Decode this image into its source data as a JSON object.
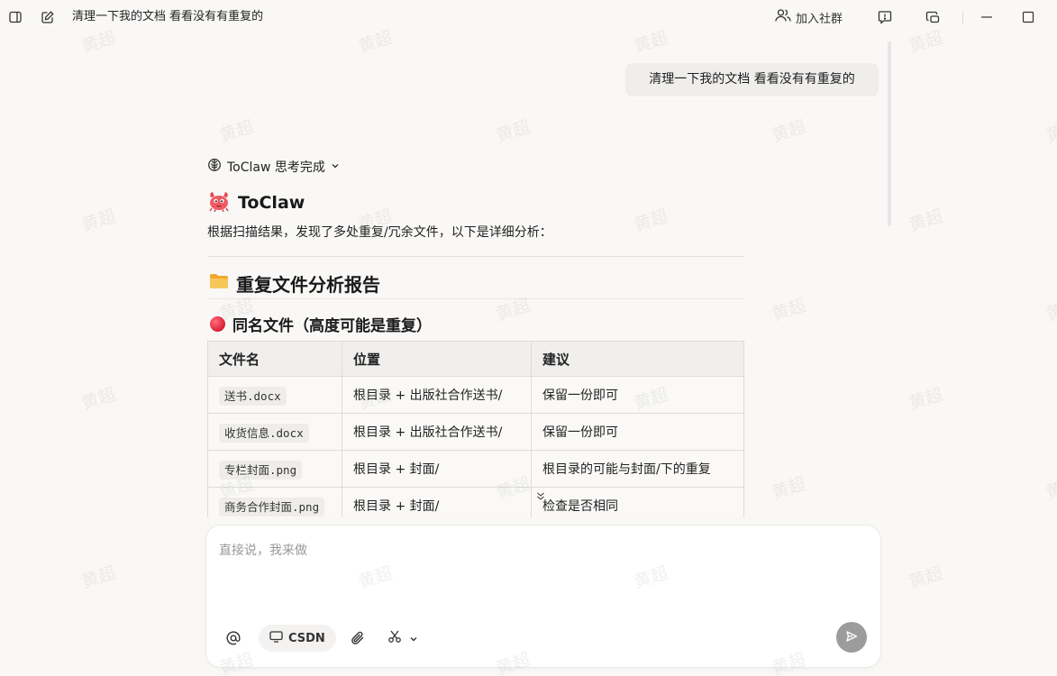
{
  "titlebar": {
    "title": "清理一下我的文档 看看没有有重复的",
    "join_label": "加入社群"
  },
  "watermark": {
    "text": "黄超"
  },
  "conversation": {
    "user_message": "清理一下我的文档 看看没有有重复的",
    "assistant": {
      "think_label": "ToClaw 思考完成",
      "bot_name": "ToClaw",
      "intro": "根据扫描结果，发现了多处重复/冗余文件，以下是详细分析：",
      "report_title": "重复文件分析报告",
      "section_title": "同名文件（高度可能是重复）",
      "table": {
        "headers": [
          "文件名",
          "位置",
          "建议"
        ],
        "rows": [
          [
            "送书.docx",
            "根目录 + 出版社合作送书/",
            "保留一份即可"
          ],
          [
            "收货信息.docx",
            "根目录 + 出版社合作送书/",
            "保留一份即可"
          ],
          [
            "专栏封面.png",
            "根目录 + 封面/",
            "根目录的可能与封面/下的重复"
          ],
          [
            "商务合作封面.png",
            "根目录 + 封面/",
            "检查是否相同"
          ]
        ]
      }
    }
  },
  "composer": {
    "placeholder": "直接说，我来做",
    "value": "",
    "chip_label": "CSDN"
  },
  "colors": {
    "background": "#f9f8f6",
    "send_button": "#9c9c9c",
    "accent_red": "#d91f36",
    "folder": "#f5b840"
  }
}
